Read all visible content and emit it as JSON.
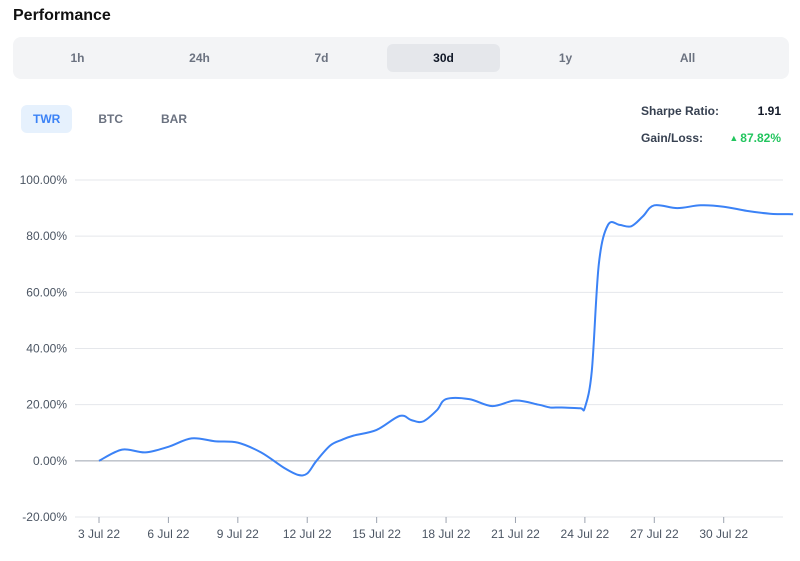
{
  "header": {
    "title": "Performance"
  },
  "ranges": [
    {
      "label": "1h",
      "active": false
    },
    {
      "label": "24h",
      "active": false
    },
    {
      "label": "7d",
      "active": false
    },
    {
      "label": "30d",
      "active": true
    },
    {
      "label": "1y",
      "active": false
    },
    {
      "label": "All",
      "active": false
    }
  ],
  "modes": [
    {
      "label": "TWR",
      "active": true
    },
    {
      "label": "BTC",
      "active": false
    },
    {
      "label": "BAR",
      "active": false
    }
  ],
  "stats": {
    "sharpe_label": "Sharpe Ratio:",
    "sharpe_value": "1.91",
    "gain_label": "Gain/Loss:",
    "gain_value": "87.82%"
  },
  "colors": {
    "line": "#3b82f6",
    "gain": "#22c55e",
    "grid": "#e5e7eb",
    "axis": "#9ca3af"
  },
  "chart_data": {
    "type": "line",
    "x_tick_labels": [
      "3 Jul 22",
      "6 Jul 22",
      "9 Jul 22",
      "12 Jul 22",
      "15 Jul 22",
      "18 Jul 22",
      "21 Jul 22",
      "24 Jul 22",
      "27 Jul 22",
      "30 Jul 22"
    ],
    "y_tick_labels": [
      "100.00%",
      "80.00%",
      "60.00%",
      "40.00%",
      "20.00%",
      "0.00%",
      "-20.00%"
    ],
    "y_ticks": [
      100,
      80,
      60,
      40,
      20,
      0,
      -20
    ],
    "ylim": [
      -20,
      100
    ],
    "xlim": [
      3,
      33.6
    ],
    "grid": true,
    "series": [
      {
        "x": [
          3,
          4,
          5,
          6,
          7,
          8,
          9,
          10,
          11,
          11.6,
          12,
          12.4,
          13,
          13.5,
          14,
          15,
          16,
          16.5,
          17,
          17.6,
          18,
          19,
          20,
          21,
          22,
          22.5,
          23,
          23.8,
          24,
          24.3,
          24.6,
          25,
          25.5,
          26,
          26.5,
          27,
          28,
          29,
          30,
          31,
          32,
          33
        ],
        "y": [
          0,
          4,
          3,
          5,
          8,
          7,
          6.5,
          3,
          -2.5,
          -5,
          -4.5,
          0,
          5.5,
          7.5,
          9,
          11,
          16,
          14.5,
          14,
          18,
          22,
          22,
          19.5,
          21.5,
          20,
          19,
          19,
          18.7,
          19,
          32,
          70,
          84,
          84,
          83.5,
          87,
          91,
          90,
          91,
          90.5,
          89,
          88,
          87.82
        ]
      }
    ]
  }
}
